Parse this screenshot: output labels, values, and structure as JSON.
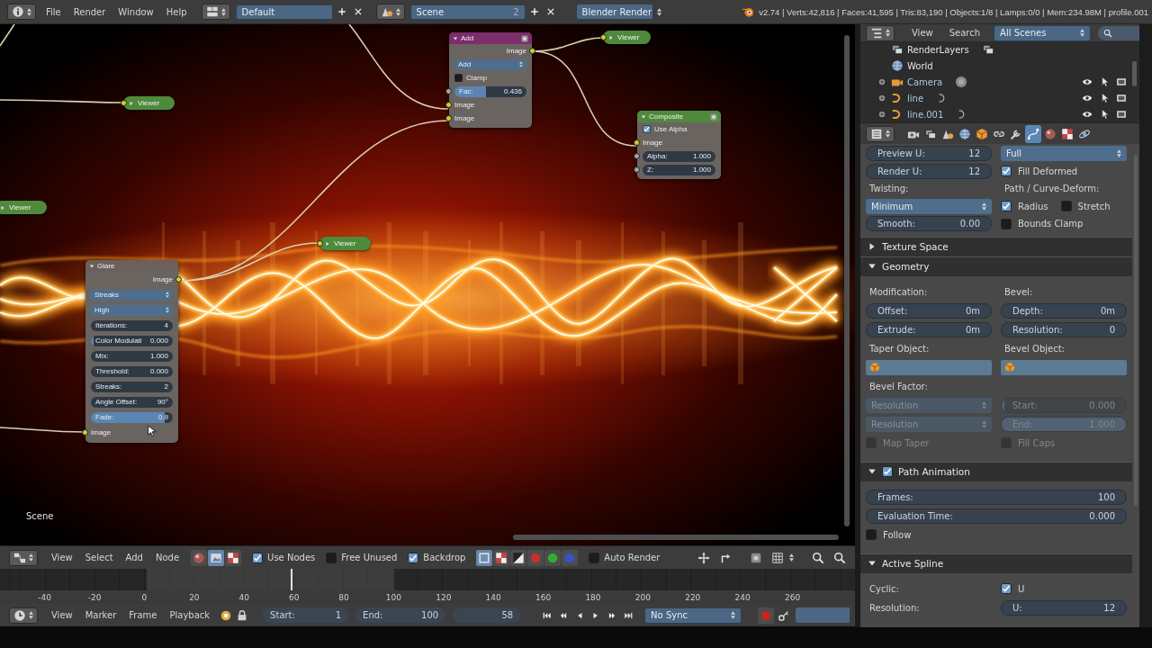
{
  "top_bar": {
    "menus": [
      "File",
      "Render",
      "Window",
      "Help"
    ],
    "layout": "Default",
    "scene": "Scene",
    "scene_users": "2",
    "engine": "Blender Render",
    "stats": "v2.74 | Verts:42,816 | Faces:41,595 | Tris:83,190 | Objects:1/8 | Lamps:0/0 | Mem:234.98M | profile.001"
  },
  "node_editor": {
    "nodes": [
      {
        "kind": "full",
        "title": "Add",
        "color": "#7c2d6c",
        "preview": true,
        "rows": [
          {
            "kind": "output",
            "label": "Image"
          },
          {
            "kind": "select",
            "value": "Add"
          },
          {
            "kind": "checkbox",
            "label": "Clamp",
            "checked": false
          },
          {
            "kind": "factor_input",
            "label": "Fac:",
            "value": "0.436",
            "level": 0.436
          },
          {
            "kind": "input",
            "label": "Image"
          },
          {
            "kind": "input",
            "label": "Image"
          }
        ]
      },
      {
        "kind": "collapsed",
        "title": "Viewer",
        "color": "#4f8a3c"
      },
      {
        "kind": "collapsed",
        "title": "Viewer",
        "color": "#4f8a3c"
      },
      {
        "kind": "full",
        "title": "Composite",
        "color": "#4f8a3c",
        "preview": true,
        "rows": [
          {
            "kind": "checkbox",
            "label": "Use Alpha",
            "checked": true
          },
          {
            "kind": "input",
            "label": "Image"
          },
          {
            "kind": "value_input",
            "label": "Alpha:",
            "value": "1.000"
          },
          {
            "kind": "value_input",
            "label": "Z:",
            "value": "1.000"
          }
        ]
      },
      {
        "kind": "collapsed",
        "title": "Viewer",
        "color": "#4f8a3c"
      },
      {
        "kind": "collapsed",
        "title": "Viewer",
        "color": "#4f8a3c"
      },
      {
        "kind": "full",
        "title": "Glare",
        "color": "#6b605b",
        "preview": false,
        "rows": [
          {
            "kind": "output",
            "label": "Image"
          },
          {
            "kind": "select",
            "value": "Streaks"
          },
          {
            "kind": "select",
            "value": "High"
          },
          {
            "kind": "number",
            "label": "Iterations:",
            "value": "4"
          },
          {
            "kind": "slider",
            "label": "Color Modulati",
            "value": "0.000",
            "level": 0
          },
          {
            "kind": "number",
            "label": "Mix:",
            "value": "1.000"
          },
          {
            "kind": "number",
            "label": "Threshold:",
            "value": "0.000"
          },
          {
            "kind": "number",
            "label": "Streaks:",
            "value": "2"
          },
          {
            "kind": "number",
            "label": "Angle Offset:",
            "value": "90°"
          },
          {
            "kind": "slider",
            "label": "Fade:",
            "value": "0.9",
            "level": 0.9
          },
          {
            "kind": "input",
            "label": "Image"
          }
        ]
      }
    ],
    "scene_label": "Scene"
  },
  "outliner": {
    "menus": [
      "View",
      "Search"
    ],
    "display": "All Scenes",
    "rows": [
      {
        "kind": "render_layers",
        "name": "RenderLayers",
        "selected": false
      },
      {
        "kind": "world",
        "name": "World",
        "selected": false
      },
      {
        "kind": "camera",
        "name": "Camera",
        "selected": false
      },
      {
        "kind": "curve",
        "name": "line",
        "selected": false
      },
      {
        "kind": "curve",
        "name": "line.001",
        "selected": false
      }
    ]
  },
  "properties": {
    "tabs": [
      {
        "kind": "render",
        "selected": false
      },
      {
        "kind": "layers",
        "selected": false
      },
      {
        "kind": "scene",
        "selected": false
      },
      {
        "kind": "world",
        "selected": false
      },
      {
        "kind": "object",
        "selected": false
      },
      {
        "kind": "constraints",
        "selected": false
      },
      {
        "kind": "modifiers",
        "selected": false
      },
      {
        "kind": "data",
        "selected": true
      },
      {
        "kind": "material",
        "selected": false
      },
      {
        "kind": "texture",
        "selected": false
      },
      {
        "kind": "physics",
        "selected": false
      }
    ],
    "panels": [
      {
        "rows": [
          {
            "disabled": false,
            "cells": [
              [
                {
                  "kind": "number",
                  "label": "Preview U:",
                  "value": "12"
                }
              ],
              [
                {
                  "kind": "select",
                  "value": "Full"
                }
              ]
            ]
          },
          {
            "disabled": false,
            "cells": [
              [
                {
                  "kind": "number",
                  "label": "Render U:",
                  "value": "12"
                }
              ],
              [
                {
                  "kind": "checkbox",
                  "label": "Fill Deformed",
                  "checked": true
                }
              ]
            ]
          },
          {
            "disabled": false,
            "cells": [
              [
                {
                  "kind": "label",
                  "text": "Twisting:"
                }
              ],
              [
                {
                  "kind": "label",
                  "text": "Path / Curve-Deform:"
                }
              ]
            ]
          },
          {
            "disabled": false,
            "cells": [
              [
                {
                  "kind": "select",
                  "value": "Minimum"
                }
              ],
              [
                {
                  "kind": "checkbox",
                  "label": "Radius",
                  "checked": true
                },
                {
                  "kind": "checkbox",
                  "label": "Stretch",
                  "checked": false
                }
              ]
            ]
          },
          {
            "disabled": false,
            "cells": [
              [
                {
                  "kind": "number",
                  "label": "Smooth:",
                  "value": "0.00"
                }
              ],
              [
                {
                  "kind": "checkbox",
                  "label": "Bounds Clamp",
                  "checked": false
                }
              ]
            ]
          }
        ]
      },
      {
        "title": "Texture Space",
        "expanded": false
      },
      {
        "title": "Geometry",
        "expanded": true,
        "rows": [
          {
            "disabled": false,
            "cells": [
              [
                {
                  "kind": "label",
                  "text": "Modification:"
                }
              ],
              [
                {
                  "kind": "label",
                  "text": "Bevel:"
                }
              ]
            ]
          },
          {
            "disabled": false,
            "cells": [
              [
                {
                  "kind": "number",
                  "label": "Offset:",
                  "value": "0m"
                }
              ],
              [
                {
                  "kind": "number",
                  "label": "Depth:",
                  "value": "0m"
                }
              ]
            ]
          },
          {
            "disabled": false,
            "cells": [
              [
                {
                  "kind": "number",
                  "label": "Extrude:",
                  "value": "0m"
                }
              ],
              [
                {
                  "kind": "number",
                  "label": "Resolution:",
                  "value": "0"
                }
              ]
            ]
          },
          {
            "disabled": false,
            "cells": [
              [
                {
                  "kind": "label",
                  "text": "Taper Object:"
                }
              ],
              [
                {
                  "kind": "label",
                  "text": "Bevel Object:"
                }
              ]
            ]
          },
          {
            "disabled": false,
            "cells": [
              [
                {
                  "kind": "object"
                }
              ],
              [
                {
                  "kind": "object"
                }
              ]
            ]
          },
          {
            "disabled": false,
            "cells": [
              [
                {
                  "kind": "label",
                  "text": "Bevel Factor:"
                }
              ]
            ]
          },
          {
            "disabled": true,
            "cells": [
              [
                {
                  "kind": "select",
                  "value": "Resolution"
                }
              ],
              [
                {
                  "kind": "slider",
                  "label": "Start:",
                  "value": "0.000",
                  "level": 0
                }
              ]
            ]
          },
          {
            "disabled": true,
            "cells": [
              [
                {
                  "kind": "select",
                  "value": "Resolution"
                }
              ],
              [
                {
                  "kind": "slider",
                  "label": "End:",
                  "value": "1.000",
                  "level": 1
                }
              ]
            ]
          },
          {
            "disabled": true,
            "cells": [
              [
                {
                  "kind": "checkbox",
                  "label": "Map Taper",
                  "checked": false
                }
              ],
              [
                {
                  "kind": "checkbox",
                  "label": "Fill Caps",
                  "checked": false
                }
              ]
            ]
          }
        ]
      },
      {
        "title": "Path Animation",
        "expanded": true,
        "toggle": {
          "checked": true
        },
        "rows": [
          {
            "disabled": false,
            "cells": [
              [
                {
                  "kind": "number",
                  "label": "Frames:",
                  "value": "100"
                }
              ]
            ]
          },
          {
            "disabled": false,
            "cells": [
              [
                {
                  "kind": "number",
                  "label": "Evaluation Time:",
                  "value": "0.000"
                }
              ]
            ]
          },
          {
            "disabled": false,
            "cells": [
              [
                {
                  "kind": "checkbox",
                  "label": "Follow",
                  "checked": false
                }
              ]
            ]
          }
        ]
      },
      {
        "title": "Active Spline",
        "expanded": true,
        "rows": [
          {
            "disabled": false,
            "cells": [
              [
                {
                  "kind": "label",
                  "text": "Cyclic:"
                }
              ],
              [
                {
                  "kind": "checkbox",
                  "label": "U",
                  "checked": true
                }
              ]
            ]
          },
          {
            "disabled": false,
            "cells": [
              [
                {
                  "kind": "label",
                  "text": "Resolution:"
                }
              ],
              [
                {
                  "kind": "number",
                  "label": "U:",
                  "value": "12"
                }
              ]
            ]
          }
        ]
      }
    ]
  },
  "node_header": {
    "menus": [
      "View",
      "Select",
      "Add",
      "Node"
    ],
    "tree_types": [
      {
        "kind": "shader",
        "selected": false
      },
      {
        "kind": "compositing",
        "selected": true
      },
      {
        "kind": "texture",
        "selected": false
      }
    ],
    "toggles": [
      {
        "label": "Use Nodes",
        "checked": true
      },
      {
        "label": "Free Unused",
        "checked": false
      },
      {
        "label": "Backdrop",
        "checked": true
      }
    ],
    "channels": [
      {
        "kind": "color",
        "selected": true
      },
      {
        "kind": "color_alpha",
        "selected": false
      },
      {
        "kind": "alpha",
        "selected": false
      },
      {
        "kind": "red",
        "selected": false
      },
      {
        "kind": "green",
        "selected": false
      },
      {
        "kind": "blue",
        "selected": false
      }
    ],
    "auto_render": {
      "label": "Auto Render",
      "checked": false
    }
  },
  "timeline": {
    "ticks": [
      "-40",
      "-20",
      "0",
      "20",
      "40",
      "60",
      "80",
      "100",
      "120",
      "140",
      "160",
      "180",
      "200",
      "220",
      "240",
      "260"
    ],
    "level": 0.34
  },
  "timeline_header": {
    "menus": [
      "View",
      "Marker",
      "Frame",
      "Playback"
    ],
    "start": {
      "label": "Start:",
      "value": "1"
    },
    "end": {
      "label": "End:",
      "value": "100"
    },
    "frame": "58",
    "sync": "No Sync"
  }
}
